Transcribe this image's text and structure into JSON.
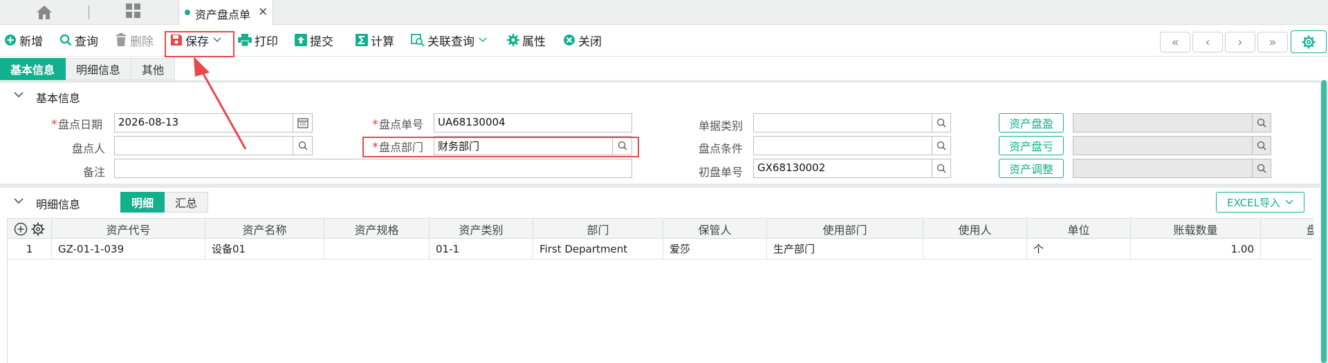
{
  "tabbar": {
    "active_tab": "资产盘点单",
    "close": "×"
  },
  "toolbar": {
    "add": "新增",
    "query": "查询",
    "delete": "删除",
    "save": "保存",
    "print": "打印",
    "submit": "提交",
    "calc": "计算",
    "linked_query": "关联查询",
    "attributes": "属性",
    "close": "关闭",
    "nav": [
      "«",
      "‹",
      "›",
      "»"
    ]
  },
  "subtabs": [
    "基本信息",
    "明细信息",
    "其他"
  ],
  "basic_section": {
    "title": "基本信息",
    "fields": {
      "check_date": {
        "label": "盘点日期",
        "value": "2026-08-13"
      },
      "check_no": {
        "label": "盘点单号",
        "value": "UA68130004"
      },
      "doc_type": {
        "label": "单据类别",
        "value": ""
      },
      "checker": {
        "label": "盘点人",
        "value": ""
      },
      "check_dept": {
        "label": "盘点部门",
        "value": "财务部门"
      },
      "check_cond": {
        "label": "盘点条件",
        "value": ""
      },
      "remark": {
        "label": "备注",
        "value": ""
      },
      "initial_no": {
        "label": "初盘单号",
        "value": "GX68130002"
      }
    },
    "buttons": {
      "surplus": "资产盘盈",
      "loss": "资产盘亏",
      "adjust": "资产调整"
    }
  },
  "detail_section": {
    "title": "明细信息",
    "toggle": [
      "明细",
      "汇总"
    ],
    "excel_import": "EXCEL导入",
    "columns": [
      "资产代号",
      "资产名称",
      "资产规格",
      "资产类别",
      "部门",
      "保管人",
      "使用部门",
      "使用人",
      "单位",
      "账载数量",
      "盘"
    ],
    "rows": [
      {
        "index": "1",
        "code": "GZ-01-1-039",
        "name": "设备01",
        "spec": "",
        "category": "01-1",
        "dept": "First Department",
        "keeper": "爱莎",
        "use_dept": "生产部门",
        "user": "",
        "unit": "个",
        "book_qty": "1.00"
      }
    ]
  },
  "colors": {
    "accent": "#13b08e",
    "highlight": "#e8474b"
  }
}
